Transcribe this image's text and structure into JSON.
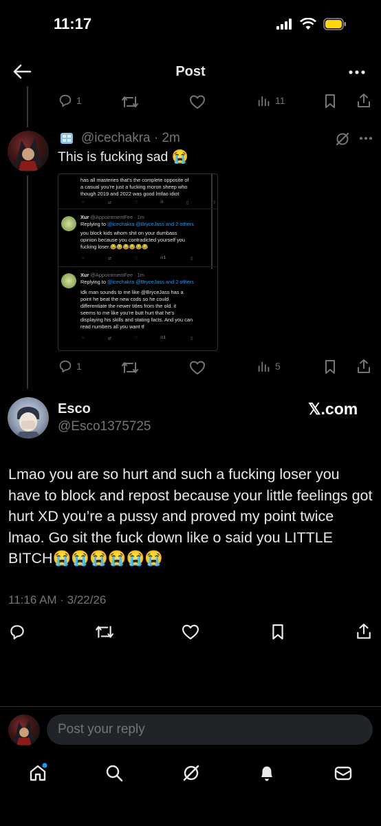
{
  "status_bar": {
    "time": "11:17"
  },
  "header": {
    "title": "Post"
  },
  "top_actions": {
    "replies": "1",
    "views": "11"
  },
  "reply_post": {
    "handle_time": "@icechakra · 2m",
    "text": "This is fucking sad 😭",
    "actions": {
      "replies": "1",
      "views": "5"
    },
    "quoted_screenshot": {
      "top_text_1": "has all masteries that's the complete opposite of",
      "top_text_2": "a casual you're just a fucking moron sheep who",
      "top_text_3": "though 2019 and 2022 was good lmfao idiot",
      "r1_name": "Xur",
      "r1_handle": "@AppointmentFee · 1m",
      "r1_replying": "Replying to ",
      "r1_replying_to": "@icechakra @BryceJass and 2 others",
      "r1_text_1": "you block kids whom shit on your dumbass",
      "r1_text_2": "opinion because you contradicted yourself you",
      "r1_text_3": "fucking loser.😂😂😂😂😂😂",
      "r1_views": "1",
      "r2_name": "Xur",
      "r2_handle": "@AppointmentFee · 1m",
      "r2_replying": "Replying to ",
      "r2_replying_to": "@icechakra @BryceJass and 2 others",
      "r2_text_1": "Idk man sounds to me like @BryceJass has a",
      "r2_text_2": "point he beat the new cods so he could",
      "r2_text_3": "differentiate the newer titles from the old. it",
      "r2_text_4": "seems to me like you're butt hurt that he's",
      "r2_text_5": "displaying his skills and stating facts. And you can",
      "r2_text_6": "read numbers all you want tf",
      "r2_views": "1"
    }
  },
  "main_post": {
    "name": "Esco",
    "handle": "@Esco1375725",
    "watermark": "𝕏.com",
    "text": "Lmao you are so hurt and such a fucking loser you have to block and repost because your little feelings got hurt XD you’re a pussy and proved my point twice lmao. Go sit the fuck down like o said you LITTLE BITCH😭😭😭😭😭😭",
    "timestamp": "11:16 AM · 3/22/26"
  },
  "reply_input": {
    "placeholder": "Post your reply"
  },
  "bottom_nav": [
    "home-icon",
    "search-icon",
    "grok-icon",
    "notifications-icon",
    "messages-icon"
  ],
  "colors": {
    "background": "#000000",
    "text": "#e7e9ea",
    "muted": "#71767b",
    "accent": "#1d9bf0",
    "battery": "#ffd60a"
  }
}
